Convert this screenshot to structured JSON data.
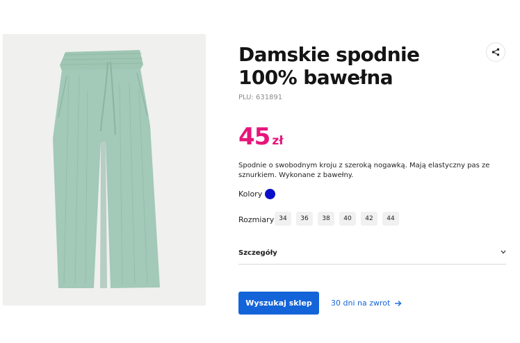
{
  "product": {
    "title": "Damskie spodnie 100% bawełna",
    "plu": "PLU: 631891",
    "price_value": "45",
    "price_currency": "zł",
    "description": "Spodnie o swobodnym kroju z szeroką nogawką. Mają elastyczny pas ze sznurkiem. Wykonane z bawełny.",
    "image_icon": "sage-green-wide-leg-trousers",
    "image_background": "#f0f0ef",
    "garment_color": "#a3c9b8"
  },
  "colors": {
    "label": "Kolory",
    "options": [
      {
        "hex": "#0a0ec8"
      }
    ]
  },
  "sizes": {
    "label": "Rozmiary",
    "options": [
      "34",
      "36",
      "38",
      "40",
      "42",
      "44"
    ]
  },
  "details": {
    "label": "Szczegóły",
    "icon": "chevron-down-icon"
  },
  "actions": {
    "find_store_label": "Wyszukaj sklep",
    "return_label": "30 dni na zwrot",
    "share_icon": "share-icon",
    "return_icon": "arrow-right-icon"
  },
  "theme": {
    "accent": "#1464d9",
    "price_color": "#e6157a"
  }
}
